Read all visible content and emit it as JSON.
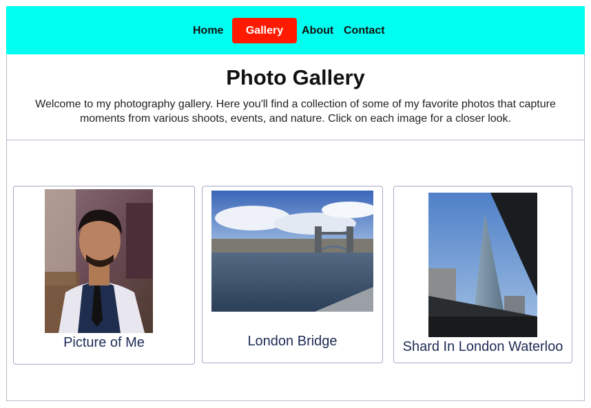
{
  "nav": {
    "items": [
      {
        "label": "Home"
      },
      {
        "label": "Gallery",
        "active": true
      },
      {
        "label": "About"
      },
      {
        "label": "Contact"
      }
    ],
    "background": "#00fff0",
    "active_color": "#ff1a00"
  },
  "header": {
    "title": "Photo Gallery",
    "intro": "Welcome to my photography gallery. Here you'll find a collection of some of my favorite photos that capture moments from various shoots, events, and nature. Click on each image for a closer look."
  },
  "gallery": {
    "photos": [
      {
        "caption": "Picture of Me"
      },
      {
        "caption": "London Bridge"
      },
      {
        "caption": "Shard In London Waterloo"
      }
    ]
  }
}
